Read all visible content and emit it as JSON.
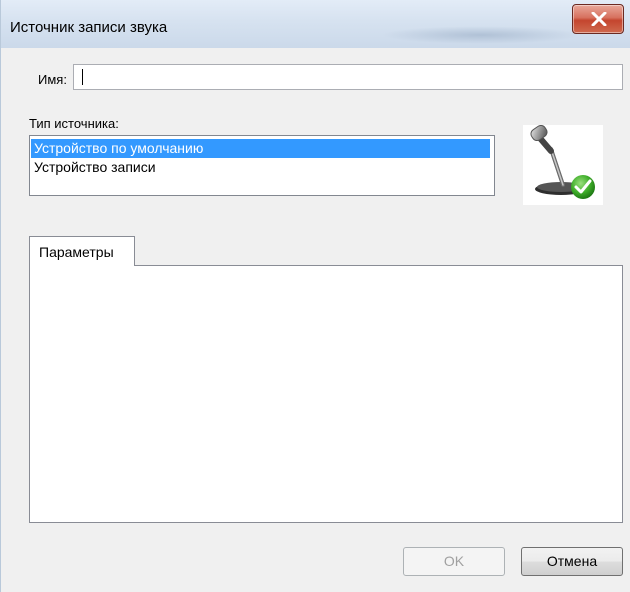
{
  "window": {
    "title": "Источник записи звука"
  },
  "name_field": {
    "label": "Имя:",
    "value": ""
  },
  "source_type": {
    "label": "Тип источника:",
    "options": [
      {
        "label": "Устройство по умолчанию",
        "selected": true
      },
      {
        "label": "Устройство записи",
        "selected": false
      }
    ]
  },
  "tabs": [
    {
      "label": "Параметры",
      "active": true
    }
  ],
  "buttons": {
    "ok_label": "OK",
    "ok_enabled": false,
    "cancel_label": "Отмена"
  },
  "icons": {
    "close": "close-icon",
    "source": "microphone-check-icon"
  },
  "colors": {
    "selection": "#3399ff",
    "close_button": "#c4452e",
    "check_green": "#3fae2a"
  }
}
